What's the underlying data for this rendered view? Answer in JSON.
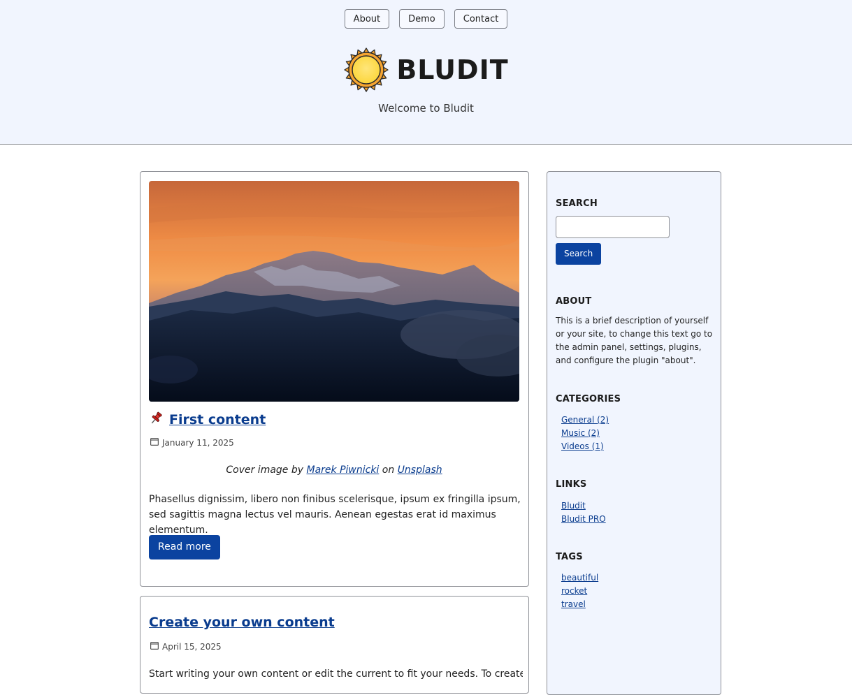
{
  "nav": {
    "items": [
      "About",
      "Demo",
      "Contact"
    ]
  },
  "site": {
    "title": "BLUDIT",
    "tagline": "Welcome to Bludit",
    "logo_icon": "sun-icon",
    "accent_color": "#0b43a0",
    "header_bg": "#f1f5fe"
  },
  "posts": [
    {
      "pinned": true,
      "title": "First content",
      "date": "January 11, 2025",
      "caption_prefix": "Cover image by",
      "caption_author": "Marek Piwnicki",
      "caption_mid": "on",
      "caption_site": "Unsplash",
      "excerpt": "Phasellus dignissim, libero non finibus scelerisque, ipsum ex fringilla ipsum, sed sagittis magna lectus vel mauris. Aenean egestas erat id maximus elementum.",
      "read_more": "Read more"
    },
    {
      "pinned": false,
      "title": "Create your own content",
      "date": "April 15, 2025",
      "excerpt": "Start writing your own content or edit the current to fit your needs. To create, edit"
    }
  ],
  "sidebar": {
    "search": {
      "heading": "SEARCH",
      "placeholder": "",
      "button": "Search"
    },
    "about": {
      "heading": "ABOUT",
      "text": "This is a brief description of yourself or your site, to change this text go to the admin panel, settings, plugins, and configure the plugin \"about\"."
    },
    "categories": {
      "heading": "CATEGORIES",
      "items": [
        "General (2)",
        "Music (2)",
        "Videos (1)"
      ]
    },
    "links": {
      "heading": "LINKS",
      "items": [
        "Bludit",
        "Bludit PRO"
      ]
    },
    "tags": {
      "heading": "TAGS",
      "items": [
        "beautiful",
        "rocket",
        "travel"
      ]
    }
  }
}
